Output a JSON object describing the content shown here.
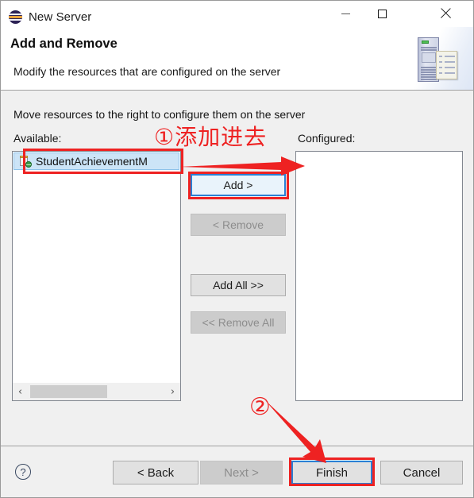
{
  "window": {
    "title": "New Server",
    "icon": "eclipse-logo-icon",
    "controls": {
      "minimize": "minimize-icon",
      "maximize": "maximize-icon",
      "close": "close-icon"
    }
  },
  "header": {
    "title": "Add and Remove",
    "description": "Modify the resources that are configured on the server",
    "banner_icon": "server-and-document-icon"
  },
  "body": {
    "instruction": "Move resources to the right to configure them on the server",
    "available_label": "Available:",
    "configured_label": "Configured:",
    "available_items": [
      {
        "label": "StudentAchievementM",
        "icon": "web-project-icon",
        "selected": true
      }
    ],
    "configured_items": [],
    "scrollbar": {
      "left_arrow": "‹",
      "right_arrow": "›"
    }
  },
  "transfer_buttons": {
    "add": "Add >",
    "remove": "< Remove",
    "add_all": "Add All >>",
    "remove_all": "<< Remove All"
  },
  "footer": {
    "help": "?",
    "back": "< Back",
    "next": "Next >",
    "finish": "Finish",
    "cancel": "Cancel"
  },
  "annotations": {
    "step1": "①添加进去",
    "step2": "②",
    "color": "#ee2222"
  }
}
